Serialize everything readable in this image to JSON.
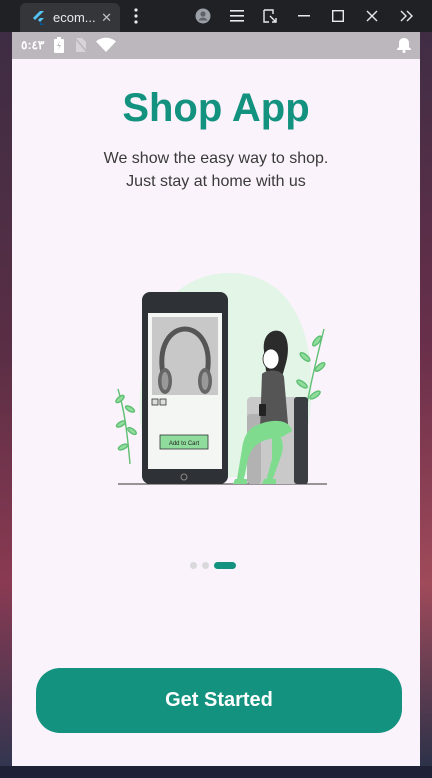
{
  "window": {
    "tab_title": "ecom...",
    "tab_close": "✕"
  },
  "statusbar": {
    "time": "٥:٤٣"
  },
  "onboarding": {
    "title": "Shop App",
    "subtitle_line1": "We show the easy way to shop.",
    "subtitle_line2": "Just stay at home with us",
    "illustration_button_text": "Add to Cart",
    "page_count": 3,
    "active_page": 3,
    "cta_label": "Get Started"
  },
  "colors": {
    "accent": "#12927f",
    "background": "#fbf3fb",
    "statusbar": "#bcb6bd",
    "inactive_dot": "#d9d9dc"
  }
}
